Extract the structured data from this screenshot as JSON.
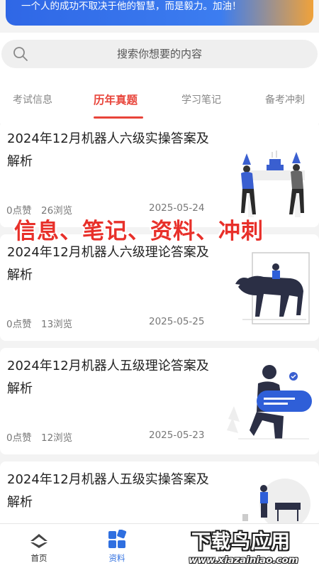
{
  "banner": {
    "quote": "一个人的成功不取决于他的智慧，而是毅力。加油！",
    "gradient_colors": [
      "#2f67e6",
      "#3c7df0",
      "#f0a23a"
    ]
  },
  "search": {
    "placeholder": "搜索你想要的内容",
    "icon": "search-icon"
  },
  "tabs": [
    {
      "label": "考试信息",
      "active": false
    },
    {
      "label": "历年真题",
      "active": true
    },
    {
      "label": "学习笔记",
      "active": false
    },
    {
      "label": "备考冲刺",
      "active": false
    }
  ],
  "articles": [
    {
      "title": "2024年12月机器人六级实操答案及解析",
      "likes": "0点赞",
      "views": "26浏览",
      "date": "2025-05-24",
      "illustration": "party-people-illustration"
    },
    {
      "title": "2024年12月机器人六级理论答案及解析",
      "likes": "0点赞",
      "views": "13浏览",
      "date": "2025-05-25",
      "illustration": "horse-rider-illustration"
    },
    {
      "title": "2024年12月机器人五级理论答案及解析",
      "likes": "0点赞",
      "views": "12浏览",
      "date": "2025-05-23",
      "illustration": "messaging-person-illustration"
    },
    {
      "title": "2024年12月机器人五级实操答案及解析",
      "likes": "",
      "views": "",
      "date": "",
      "illustration": "person-with-sign-illustration"
    }
  ],
  "overlay_caption": "信息、笔记、资料、冲刺",
  "bottom_nav": [
    {
      "label": "首页",
      "icon": "home-icon",
      "active": false
    },
    {
      "label": "资料",
      "icon": "grid-icon",
      "active": true
    }
  ],
  "watermark": {
    "main": "下载鸟应用",
    "url": "www.xiazainiao.com"
  },
  "colors": {
    "accent": "#e8443a",
    "nav_active": "#2f6fe0"
  }
}
